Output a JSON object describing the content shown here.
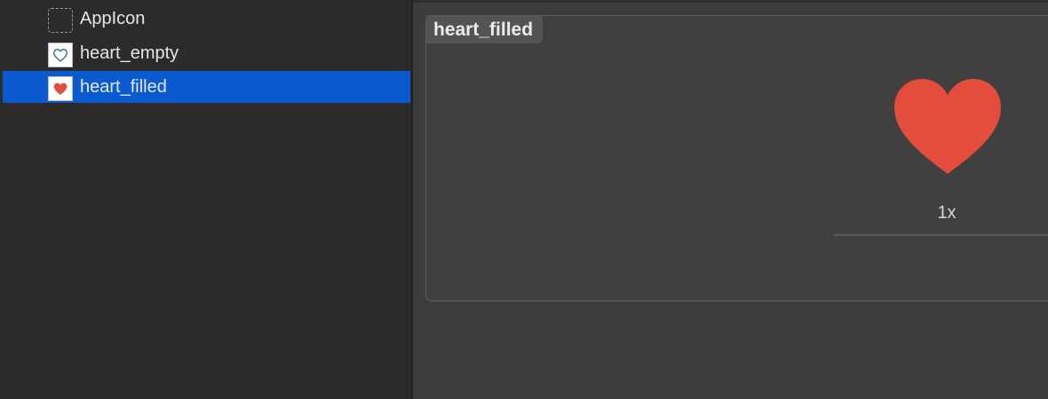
{
  "sidebar": {
    "items": [
      {
        "label": "AppIcon",
        "icon": "app-icon-placeholder",
        "selected": false
      },
      {
        "label": "heart_empty",
        "icon": "heart-outline-icon",
        "selected": false
      },
      {
        "label": "heart_filled",
        "icon": "heart-filled-icon",
        "selected": true
      }
    ]
  },
  "editor": {
    "set_name": "heart_filled",
    "slot_label": "1x",
    "image_icon": "heart-filled-icon"
  },
  "colors": {
    "selection": "#0a5bd0",
    "heart": "#e44d3c",
    "heart_outline": "#1b6f8a",
    "background": "#2c2b2a"
  }
}
